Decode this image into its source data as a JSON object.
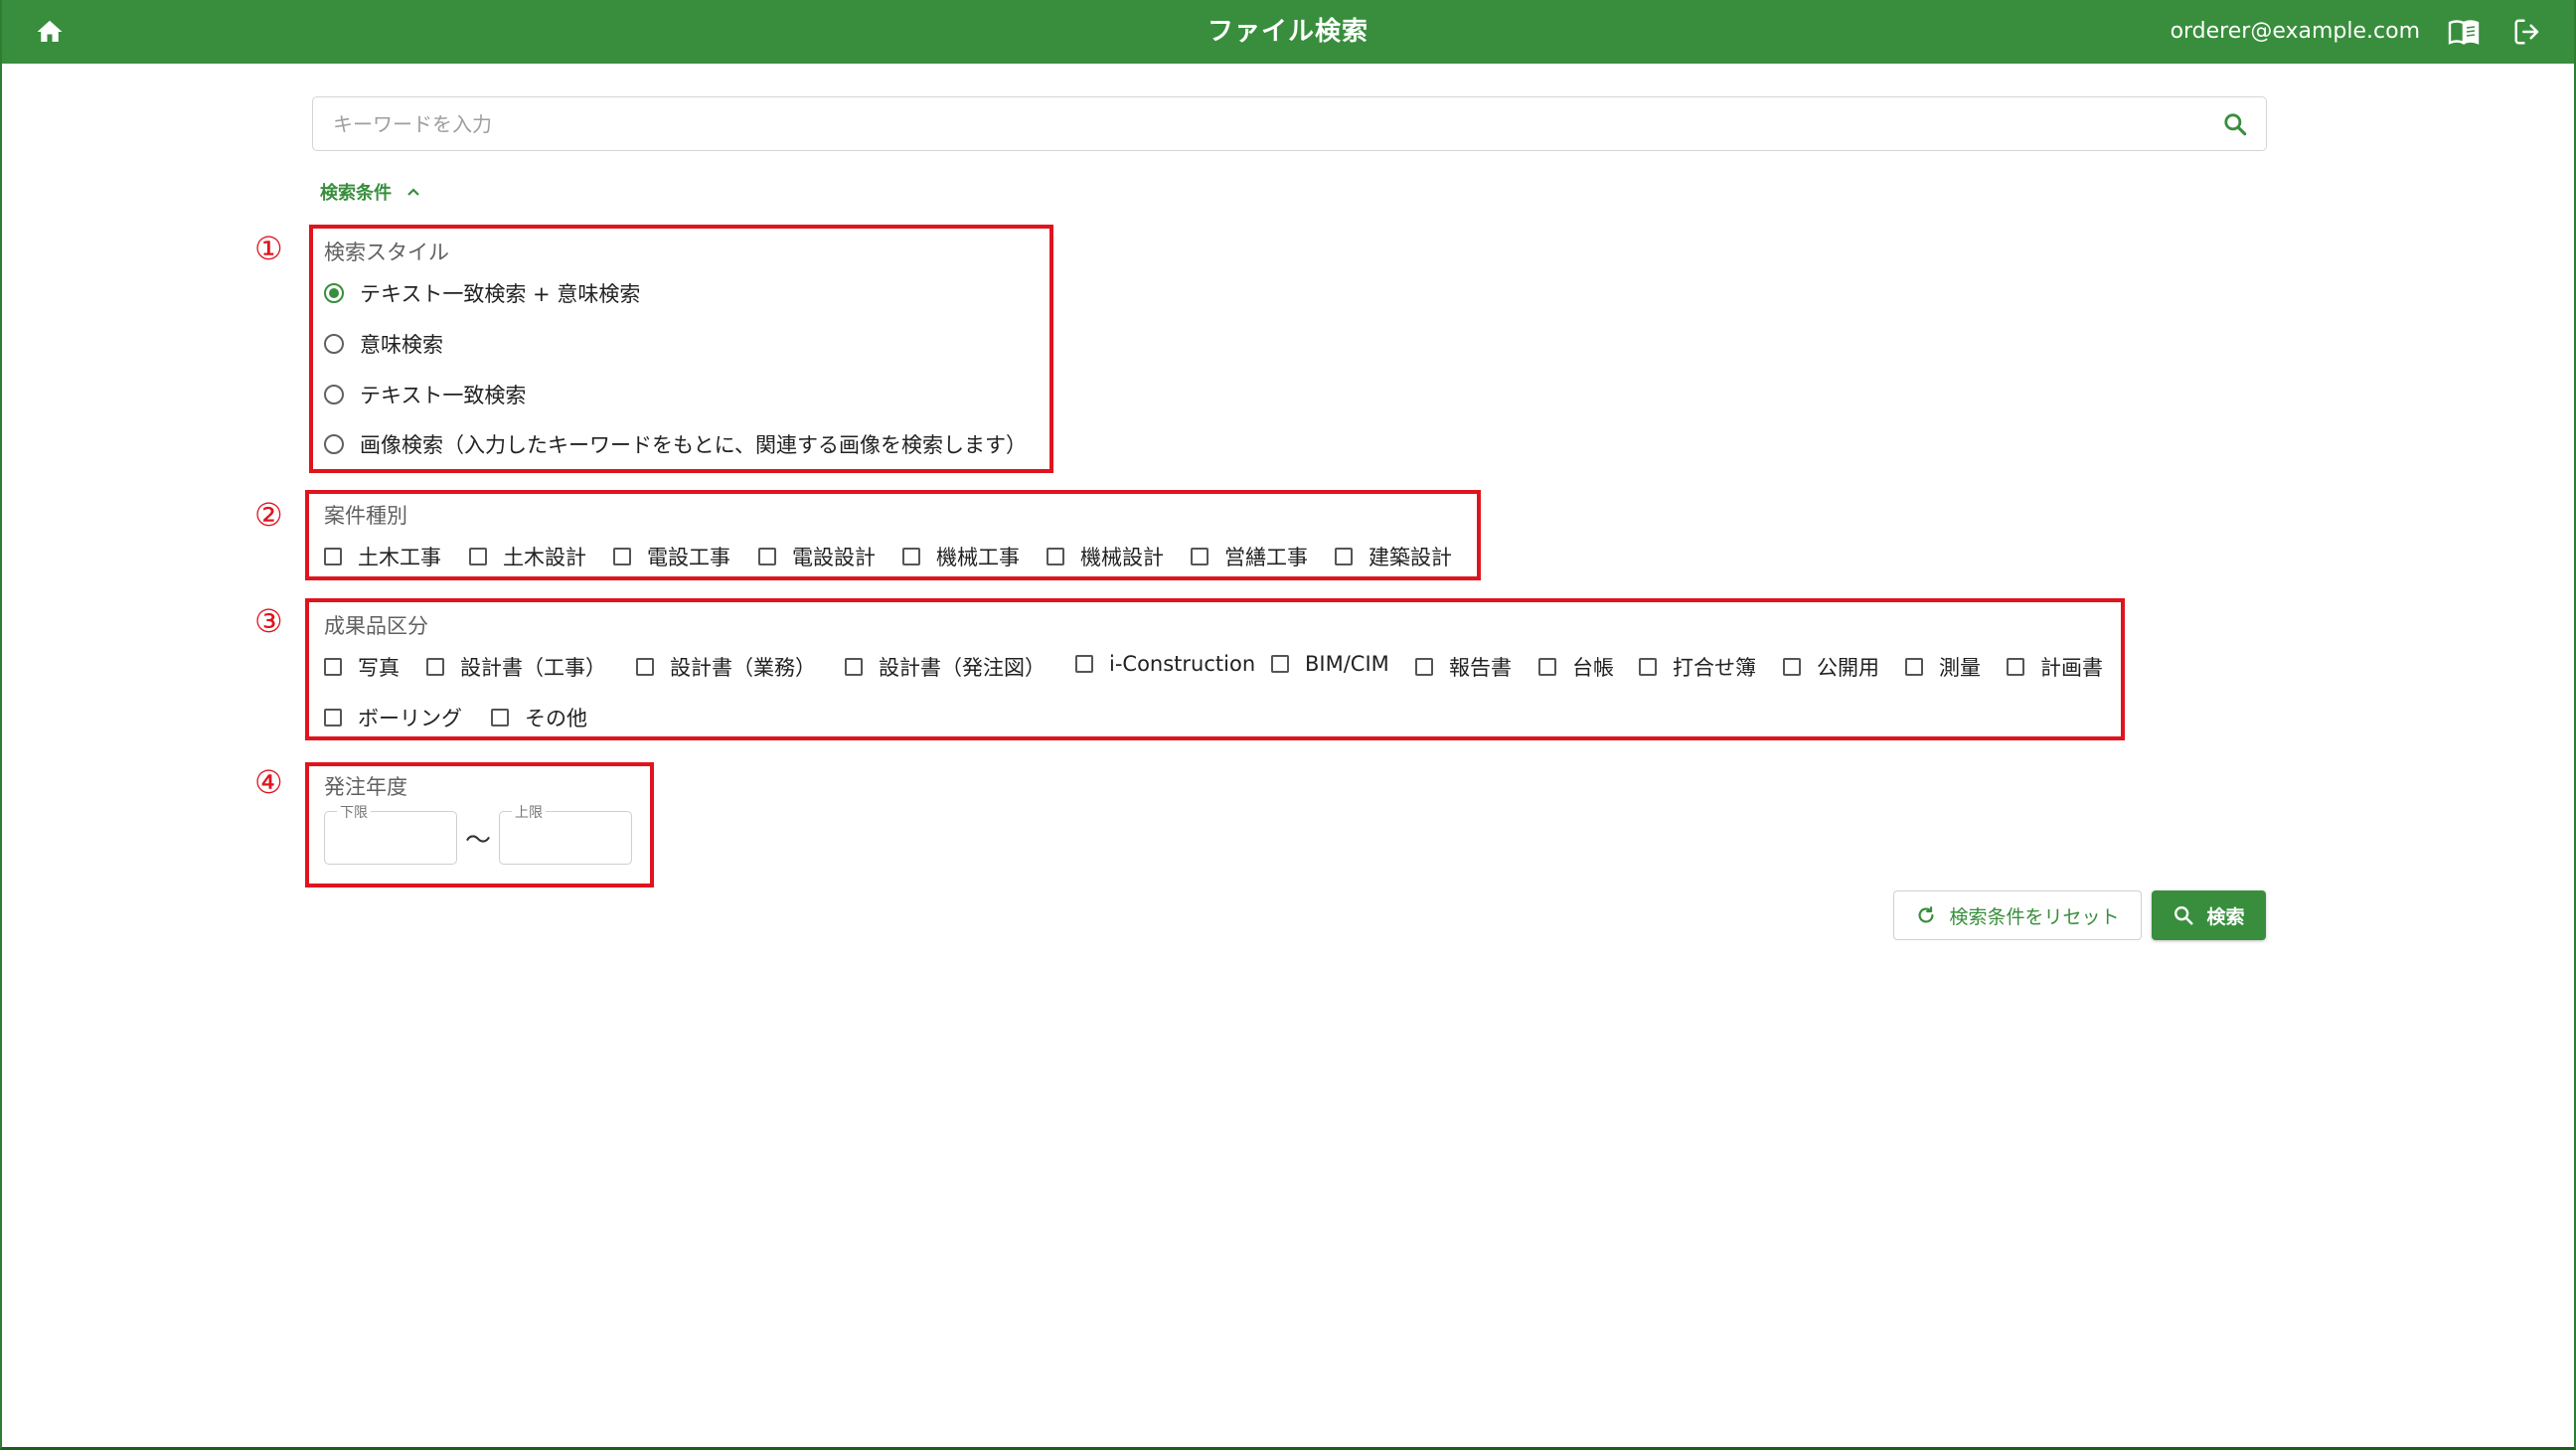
{
  "header": {
    "title": "ファイル検索",
    "user_email": "orderer@example.com",
    "icons": {
      "home": "home-icon",
      "manual": "book-icon",
      "logout": "logout-icon"
    }
  },
  "search": {
    "placeholder": "キーワードを入力",
    "value": ""
  },
  "conditions_toggle": {
    "label": "検索条件",
    "expanded": true
  },
  "annotations": [
    "①",
    "②",
    "③",
    "④"
  ],
  "search_style": {
    "label": "検索スタイル",
    "options": [
      {
        "label": "テキスト一致検索 + 意味検索",
        "selected": true
      },
      {
        "label": "意味検索",
        "selected": false
      },
      {
        "label": "テキスト一致検索",
        "selected": false
      },
      {
        "label": "画像検索（入力したキーワードをもとに、関連する画像を検索します）",
        "selected": false
      }
    ]
  },
  "project_type": {
    "label": "案件種別",
    "options": [
      "土木工事",
      "土木設計",
      "電設工事",
      "電設設計",
      "機械工事",
      "機械設計",
      "営繕工事",
      "建築設計"
    ]
  },
  "deliverable_type": {
    "label": "成果品区分",
    "options_row1": [
      "写真",
      "設計書（工事）",
      "設計書（業務）",
      "設計書（発注図）",
      "i-Construction",
      "BIM/CIM",
      "報告書",
      "台帳",
      "打合せ簿",
      "公開用",
      "測量",
      "計画書"
    ],
    "options_row2": [
      "ボーリング",
      "その他"
    ]
  },
  "order_year": {
    "label": "発注年度",
    "lower_label": "下限",
    "upper_label": "上限",
    "lower_value": "",
    "upper_value": "",
    "separator": "～"
  },
  "buttons": {
    "reset_label": "検索条件をリセット",
    "search_label": "検索"
  },
  "colors": {
    "primary": "#388e3c",
    "annotation_red": "#e0141e"
  }
}
